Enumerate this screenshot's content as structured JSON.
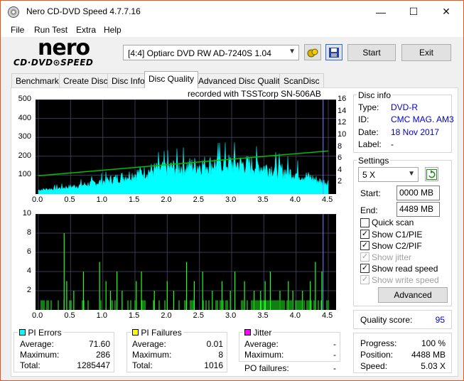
{
  "window": {
    "title": "Nero CD-DVD Speed 4.7.7.16",
    "min": "—",
    "max": "☐",
    "close": "✕"
  },
  "menu": [
    "File",
    "Run Test",
    "Extra",
    "Help"
  ],
  "logo": {
    "line1": "nero",
    "line2": "CD·DVD⊙SPEED"
  },
  "drive": {
    "value": "[4:4]  Optiarc DVD RW AD-7240S 1.04"
  },
  "toolbar": {
    "start": "Start",
    "exit": "Exit"
  },
  "tabs": [
    "Benchmark",
    "Create Disc",
    "Disc Info",
    "Disc Quality",
    "Advanced Disc Quality",
    "ScanDisc"
  ],
  "active_tab": "Disc Quality",
  "recorded": "recorded with TSSTcorp SN-506AB",
  "disc_info": {
    "title": "Disc info",
    "type_label": "Type:",
    "type": "DVD-R",
    "id_label": "ID:",
    "id": "CMC MAG. AM3",
    "date_label": "Date:",
    "date": "18 Nov 2017",
    "label_label": "Label:",
    "label": "-"
  },
  "settings": {
    "title": "Settings",
    "speed": "5 X",
    "start_label": "Start:",
    "start": "0000 MB",
    "end_label": "End:",
    "end": "4489 MB",
    "checks": [
      {
        "label": "Quick scan",
        "checked": false,
        "disabled": false
      },
      {
        "label": "Show C1/PIE",
        "checked": true,
        "disabled": false
      },
      {
        "label": "Show C2/PIF",
        "checked": true,
        "disabled": false
      },
      {
        "label": "Show jitter",
        "checked": true,
        "disabled": true
      },
      {
        "label": "Show read speed",
        "checked": true,
        "disabled": false
      },
      {
        "label": "Show write speed",
        "checked": true,
        "disabled": true
      }
    ],
    "advanced": "Advanced"
  },
  "quality": {
    "label": "Quality score:",
    "value": "95"
  },
  "progress": {
    "progress_label": "Progress:",
    "progress": "100 %",
    "position_label": "Position:",
    "position": "4488 MB",
    "speed_label": "Speed:",
    "speed": "5.03 X"
  },
  "stats": {
    "pi_errors": {
      "title": "PI Errors",
      "color": "#00ffff",
      "average_label": "Average:",
      "average": "71.60",
      "maximum_label": "Maximum:",
      "maximum": "286",
      "total_label": "Total:",
      "total": "1285447"
    },
    "pi_failures": {
      "title": "PI Failures",
      "color": "#ffff00",
      "average_label": "Average:",
      "average": "0.01",
      "maximum_label": "Maximum:",
      "maximum": "8",
      "total_label": "Total:",
      "total": "1016"
    },
    "jitter": {
      "title": "Jitter",
      "color": "#ff00ff",
      "average_label": "Average:",
      "average": "-",
      "maximum_label": "Maximum:",
      "maximum": "-"
    },
    "po_failures": {
      "label": "PO failures:",
      "value": "-"
    }
  },
  "chart_data": [
    {
      "type": "area",
      "name": "PI Errors",
      "x_ticks": [
        "0.0",
        "0.5",
        "1.0",
        "1.5",
        "2.0",
        "2.5",
        "3.0",
        "3.5",
        "4.0",
        "4.5"
      ],
      "y_ticks_left": [
        "500",
        "400",
        "300",
        "200",
        "100"
      ],
      "y_ticks_right": [
        "16",
        "14",
        "12",
        "10",
        "8",
        "6",
        "4",
        "2"
      ],
      "xlim": [
        0,
        4.5
      ],
      "ylim": [
        0,
        500
      ],
      "y2lim": [
        0,
        16
      ],
      "pi_envelope": {
        "x": [
          0.0,
          0.3,
          0.6,
          0.9,
          1.2,
          1.5,
          1.8,
          2.1,
          2.4,
          2.7,
          3.0,
          3.3,
          3.6,
          3.9,
          4.2,
          4.4
        ],
        "y": [
          25,
          35,
          50,
          70,
          95,
          125,
          150,
          165,
          175,
          185,
          190,
          180,
          160,
          135,
          105,
          75
        ]
      },
      "read_speed": {
        "x": [
          0.0,
          4.5
        ],
        "y": [
          3.1,
          7.3
        ]
      }
    },
    {
      "type": "bar",
      "name": "PI Failures",
      "x_ticks": [
        "0.0",
        "0.5",
        "1.0",
        "1.5",
        "2.0",
        "2.5",
        "3.0",
        "3.5",
        "4.0",
        "4.5"
      ],
      "y_ticks_left": [
        "10",
        "8",
        "6",
        "4",
        "2"
      ],
      "xlim": [
        0,
        4.5
      ],
      "ylim": [
        0,
        10
      ],
      "spikes": {
        "x": [
          0.4,
          0.44,
          0.55,
          0.7,
          0.95,
          1.05,
          1.12,
          1.22,
          1.3,
          1.52,
          1.6,
          1.8,
          2.0,
          2.1,
          2.3,
          2.42,
          2.55,
          2.7,
          2.85,
          2.98,
          3.05,
          3.2,
          3.35,
          3.45,
          3.52,
          3.6,
          3.75,
          3.88,
          3.95,
          4.1,
          4.22,
          4.3,
          4.4
        ],
        "y": [
          8,
          3,
          2,
          4,
          5,
          3,
          2,
          4,
          2,
          3,
          4,
          2,
          3,
          2,
          5,
          3,
          4,
          2,
          3,
          2,
          4,
          3,
          2,
          2,
          3,
          4,
          2,
          3,
          2,
          2,
          3,
          5,
          4
        ]
      }
    }
  ]
}
